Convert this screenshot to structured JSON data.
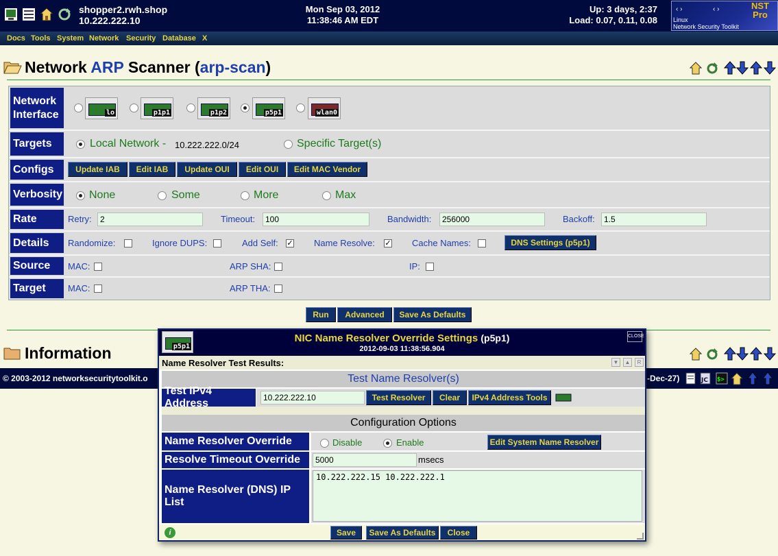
{
  "topbar": {
    "hostname": "shopper2.rwh.shop",
    "ip": "10.222.222.10",
    "date": "Mon Sep 03, 2012",
    "time": "11:38:46 AM EDT",
    "uptime": "Up: 3 days, 2:37",
    "load": "Load: 0.07, 0.11, 0.08",
    "logo_nst": "NST",
    "logo_pro": "Pro",
    "logo_linux": "Linux",
    "logo_sub": "Network Security Toolkit"
  },
  "menu": [
    "Docs",
    "Tools",
    "System",
    "Network",
    "Security",
    "Database",
    "X"
  ],
  "page": {
    "title_prefix": "Network ",
    "title_arp": "ARP",
    "title_mid": " Scanner (",
    "title_cmd": "arp-scan",
    "title_suffix": ")"
  },
  "form": {
    "network_interface_label": "Network Interface",
    "interfaces": [
      {
        "name": "lo",
        "selected": false
      },
      {
        "name": "p1p1",
        "selected": false
      },
      {
        "name": "p1p2",
        "selected": false
      },
      {
        "name": "p5p1",
        "selected": true
      },
      {
        "name": "wlan0",
        "selected": false
      }
    ],
    "targets_label": "Targets",
    "local_network_label": "Local Network -",
    "local_network_value": "10.222.222.0/24",
    "specific_targets_label": "Specific Target(s)",
    "configs_label": "Configs",
    "config_buttons": [
      "Update IAB",
      "Edit IAB",
      "Update OUI",
      "Edit OUI",
      "Edit MAC Vendor"
    ],
    "verbosity_label": "Verbosity",
    "verbosity_options": [
      "None",
      "Some",
      "More",
      "Max"
    ],
    "verbosity_selected": "None",
    "rate_label": "Rate",
    "retry_label": "Retry:",
    "retry_value": "2",
    "timeout_label": "Timeout:",
    "timeout_value": "100",
    "bandwidth_label": "Bandwidth:",
    "bandwidth_value": "256000",
    "backoff_label": "Backoff:",
    "backoff_value": "1.5",
    "details_label": "Details",
    "randomize_label": "Randomize:",
    "ignore_dups_label": "Ignore DUPS:",
    "add_self_label": "Add Self:",
    "name_resolve_label": "Name Resolve:",
    "cache_names_label": "Cache Names:",
    "dns_settings_button": "DNS Settings (p5p1)",
    "source_label": "Source",
    "target_label": "Target",
    "mac_label": "MAC:",
    "arp_sha_label": "ARP SHA:",
    "ip_label": "IP:",
    "arp_tha_label": "ARP THA:",
    "checkmark": "✓"
  },
  "actions": {
    "run": "Run",
    "advanced": "Advanced",
    "save_defaults": "Save As Defaults"
  },
  "information": {
    "heading": "Information"
  },
  "footer": {
    "copyright": "© 2003-2012 networksecuritytoolkit.o",
    "version_tail": "-Dec-27)"
  },
  "dialog": {
    "nic": "p5p1",
    "title": "NIC Name Resolver Override Settings",
    "title_nic": "(p5p1)",
    "timestamp": "2012-09-03 11:38:56.904",
    "close": "CLOSE",
    "results_label": "Name Resolver Test Results:",
    "test_header": "Test Name Resolver(s)",
    "test_ipv4_label": "Test IPv4 Address",
    "test_ipv4_value": "10.222.222.10",
    "test_resolver_button": "Test Resolver",
    "clear_button": "Clear",
    "ipv4_tools_button": "IPv4 Address Tools",
    "config_header": "Configuration Options",
    "override_label": "Name Resolver Override",
    "disable_label": "Disable",
    "enable_label": "Enable",
    "edit_system_button": "Edit System Name Resolver",
    "timeout_label": "Resolve Timeout Override",
    "timeout_value": "5000",
    "timeout_unit": "msecs",
    "dns_list_label": "Name Resolver (DNS) IP List",
    "dns_list_value": "10.222.222.15 10.222.222.1",
    "save_button": "Save",
    "save_defaults_button": "Save As Defaults",
    "close_button": "Close",
    "info_icon": "i"
  },
  "colors": {
    "header_bg": "#000a3c",
    "label_bg": "#0f1e84",
    "button_bg": "#10306c",
    "button_text": "#e8d640",
    "green_text": "#1c7a1c",
    "blue_text": "#1f3fae"
  }
}
